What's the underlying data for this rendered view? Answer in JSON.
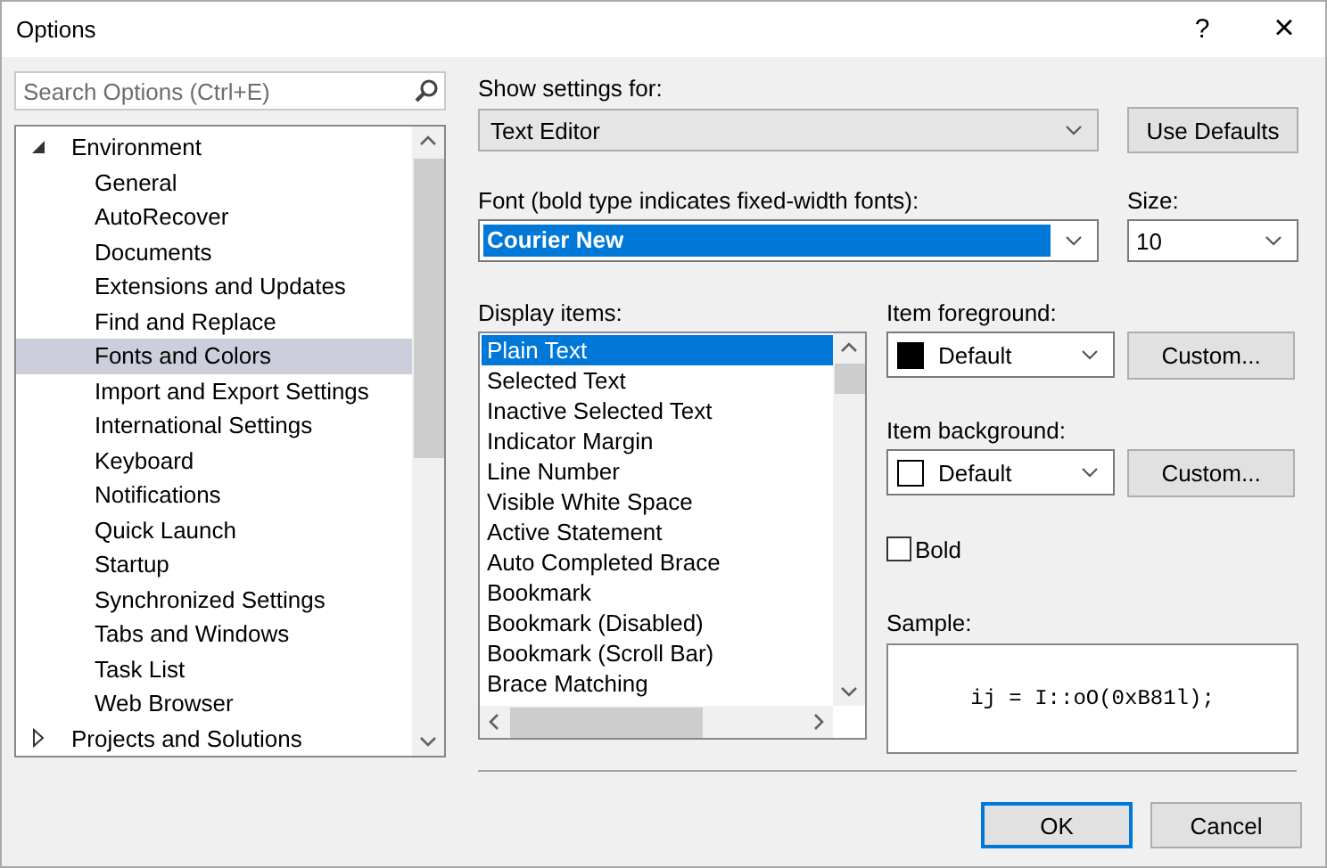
{
  "window": {
    "title": "Options",
    "help": "?",
    "close": "×"
  },
  "search": {
    "placeholder": "Search Options (Ctrl+E)"
  },
  "tree": [
    {
      "label": "Environment",
      "expanded": true,
      "selected": false,
      "children": [
        {
          "label": "General",
          "selected": false
        },
        {
          "label": "AutoRecover",
          "selected": false
        },
        {
          "label": "Documents",
          "selected": false
        },
        {
          "label": "Extensions and Updates",
          "selected": false
        },
        {
          "label": "Find and Replace",
          "selected": false
        },
        {
          "label": "Fonts and Colors",
          "selected": true
        },
        {
          "label": "Import and Export Settings",
          "selected": false
        },
        {
          "label": "International Settings",
          "selected": false
        },
        {
          "label": "Keyboard",
          "selected": false
        },
        {
          "label": "Notifications",
          "selected": false
        },
        {
          "label": "Quick Launch",
          "selected": false
        },
        {
          "label": "Startup",
          "selected": false
        },
        {
          "label": "Synchronized Settings",
          "selected": false
        },
        {
          "label": "Tabs and Windows",
          "selected": false
        },
        {
          "label": "Task List",
          "selected": false
        },
        {
          "label": "Web Browser",
          "selected": false
        }
      ]
    },
    {
      "label": "Projects and Solutions",
      "expanded": false,
      "selected": false
    }
  ],
  "show_settings": {
    "label": "Show settings for:",
    "value": "Text Editor",
    "button": "Use Defaults"
  },
  "font": {
    "label": "Font (bold type indicates fixed-width fonts):",
    "value": "Courier New",
    "size_label": "Size:",
    "size_value": "10"
  },
  "display_items": {
    "label": "Display items:",
    "items": [
      {
        "label": "Plain Text",
        "selected": true
      },
      {
        "label": "Selected Text",
        "selected": false
      },
      {
        "label": "Inactive Selected Text",
        "selected": false
      },
      {
        "label": "Indicator Margin",
        "selected": false
      },
      {
        "label": "Line Number",
        "selected": false
      },
      {
        "label": "Visible White Space",
        "selected": false
      },
      {
        "label": "Active Statement",
        "selected": false
      },
      {
        "label": "Auto Completed Brace",
        "selected": false
      },
      {
        "label": "Bookmark",
        "selected": false
      },
      {
        "label": "Bookmark (Disabled)",
        "selected": false
      },
      {
        "label": "Bookmark (Scroll Bar)",
        "selected": false
      },
      {
        "label": "Brace Matching",
        "selected": false
      }
    ]
  },
  "colors": [
    {
      "label": "Item foreground:",
      "value": "Default",
      "color": "#000000",
      "button": "Custom..."
    },
    {
      "label": "Item background:",
      "value": "Default",
      "color": "#ffffff",
      "button": "Custom..."
    }
  ],
  "bold": {
    "label": "Bold",
    "checked": false
  },
  "sample": {
    "label": "Sample:",
    "text": "ij = I::oO(0xB81l);"
  },
  "buttons": [
    {
      "label": "OK",
      "default": true
    },
    {
      "label": "Cancel",
      "default": false
    }
  ]
}
